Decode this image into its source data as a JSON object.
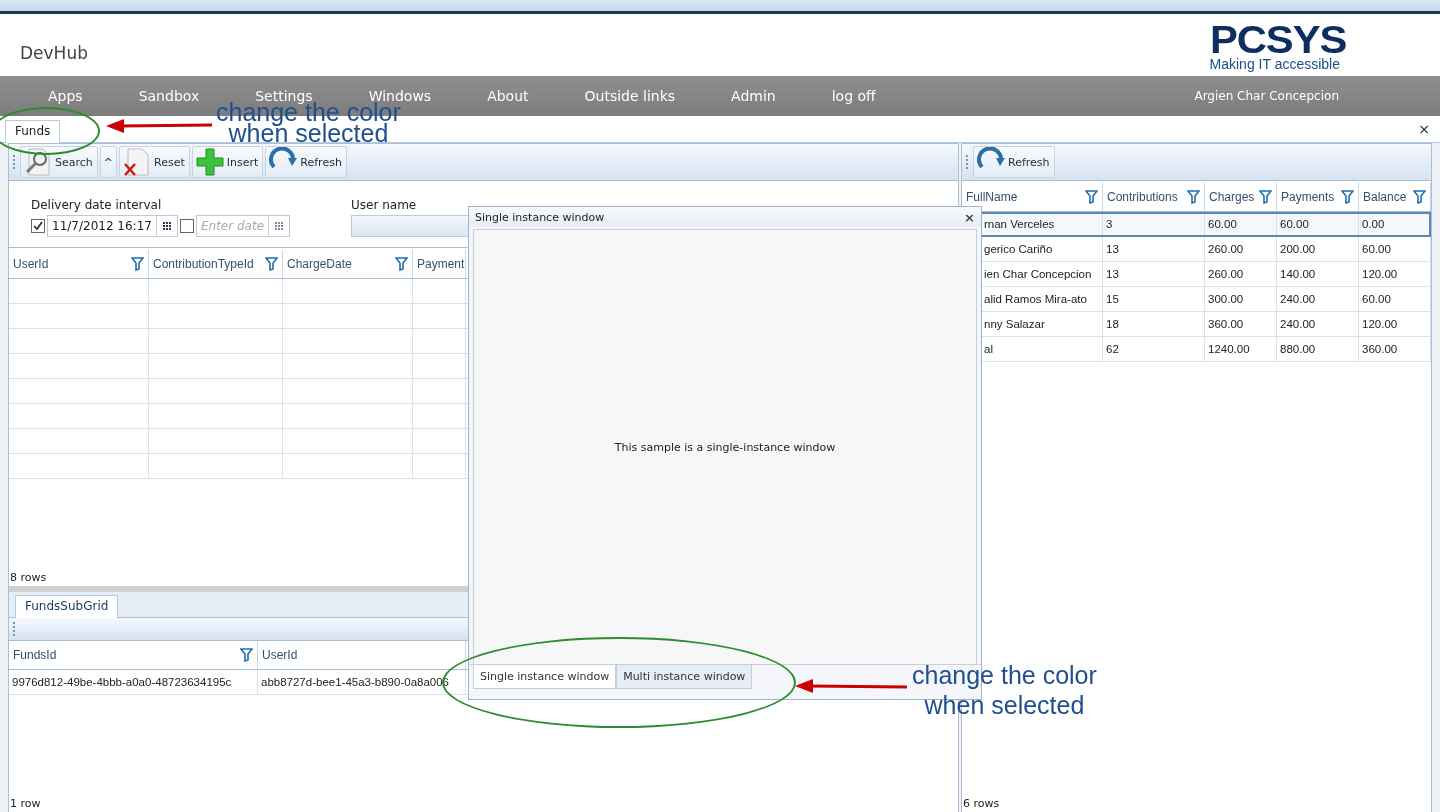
{
  "header": {
    "title": "DevHub",
    "logo_name": "PCSYS",
    "logo_tagline": "Making IT accessible"
  },
  "nav": {
    "items": [
      "Apps",
      "Sandbox",
      "Settings",
      "Windows",
      "About",
      "Outside links",
      "Admin",
      "log off"
    ],
    "user": "Argien Char Concepcion"
  },
  "tabs": [
    {
      "label": "Funds",
      "selected": true
    }
  ],
  "tabs_close": "×",
  "funds_panel": {
    "toolbar": [
      {
        "kind": "search",
        "label": "Search"
      },
      {
        "kind": "collapse",
        "label": "^"
      },
      {
        "kind": "reset",
        "label": "Reset"
      },
      {
        "kind": "insert",
        "label": "Insert"
      },
      {
        "kind": "refresh",
        "label": "Refresh"
      }
    ],
    "filters": {
      "date_label": "Delivery date interval",
      "from": {
        "checked": true,
        "value": "11/7/2012 16:17"
      },
      "to": {
        "checked": false,
        "placeholder": "Enter date"
      },
      "user_label": "User name"
    },
    "columns": [
      {
        "label": "UserId",
        "filterable": true
      },
      {
        "label": "ContributionTypeId",
        "filterable": true
      },
      {
        "label": "ChargeDate",
        "filterable": true
      },
      {
        "label": "Payment",
        "filterable": false
      }
    ],
    "footer": "8 rows"
  },
  "subgrid": {
    "tab": "FundsSubGrid",
    "columns": [
      {
        "label": "FundsId",
        "filterable": true
      },
      {
        "label": "UserId",
        "filterable": false
      }
    ],
    "rows": [
      [
        "9976d812-49be-4bbb-a0a0-48723634195c",
        "abb8727d-bee1-45a3-b890-0a8a006"
      ]
    ],
    "footer": "1 row"
  },
  "summary_panel": {
    "toolbar": [
      {
        "kind": "refresh",
        "label": "Refresh"
      }
    ],
    "columns": [
      {
        "label": "FullName",
        "filterable": true
      },
      {
        "label": "Contributions",
        "filterable": true
      },
      {
        "label": "Charges",
        "filterable": true
      },
      {
        "label": "Payments",
        "filterable": true
      },
      {
        "label": "Balance",
        "filterable": true
      }
    ],
    "rows": [
      {
        "selected": true,
        "cells": [
          "rnan Verceles",
          "3",
          "60.00",
          "60.00",
          "0.00"
        ]
      },
      {
        "selected": false,
        "cells": [
          "gerico Cariño",
          "13",
          "260.00",
          "200.00",
          "60.00"
        ]
      },
      {
        "selected": false,
        "cells": [
          "ien Char Concepcion",
          "13",
          "260.00",
          "140.00",
          "120.00"
        ]
      },
      {
        "selected": false,
        "cells": [
          "alid Ramos Mira-ato",
          "15",
          "300.00",
          "240.00",
          "60.00"
        ]
      },
      {
        "selected": false,
        "cells": [
          "nny Salazar",
          "18",
          "360.00",
          "240.00",
          "120.00"
        ]
      },
      {
        "selected": false,
        "cells": [
          "al",
          "62",
          "1240.00",
          "880.00",
          "360.00"
        ]
      }
    ],
    "footer": "6 rows"
  },
  "window": {
    "title": "Single instance window",
    "close": "×",
    "message": "This sample is a single-instance window",
    "tabs": [
      {
        "label": "Single instance window",
        "selected": true
      },
      {
        "label": "Multi instance window",
        "selected": false
      }
    ]
  },
  "annotations": [
    {
      "text": "change the color\nwhen selected"
    },
    {
      "text": "change the color\nwhen selected"
    }
  ]
}
